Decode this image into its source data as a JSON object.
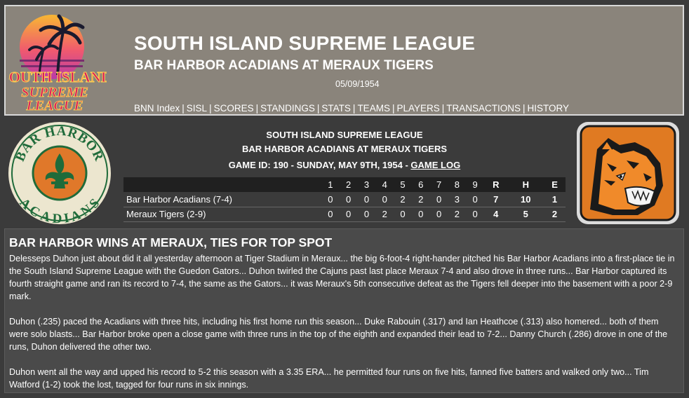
{
  "header": {
    "logo_text": [
      "SOUTH ISLAND",
      "SUPREME",
      "LEAGUE"
    ],
    "title": "SOUTH ISLAND SUPREME LEAGUE",
    "subtitle": "BAR HARBOR ACADIANS AT MERAUX TIGERS",
    "date": "05/09/1954",
    "nav": [
      "BNN Index",
      "SISL",
      "SCORES",
      "STANDINGS",
      "STATS",
      "TEAMS",
      "PLAYERS",
      "TRANSACTIONS",
      "HISTORY"
    ]
  },
  "game": {
    "league": "SOUTH ISLAND SUPREME LEAGUE",
    "matchup": "BAR HARBOR ACADIANS AT MERAUX TIGERS",
    "game_id_text": "GAME ID: 190 - SUNDAY, MAY 9TH, 1954 - ",
    "game_log_label": "GAME LOG",
    "away_logo_text": [
      "BAR HARBOR",
      "ACADIANS"
    ]
  },
  "boxscore": {
    "columns": [
      "1",
      "2",
      "3",
      "4",
      "5",
      "6",
      "7",
      "8",
      "9",
      "R",
      "H",
      "E"
    ],
    "rows": [
      {
        "team": "Bar Harbor Acadians (7-4)",
        "innings": [
          "0",
          "0",
          "0",
          "0",
          "2",
          "2",
          "0",
          "3",
          "0"
        ],
        "r": "7",
        "h": "10",
        "e": "1"
      },
      {
        "team": "Meraux Tigers (2-9)",
        "innings": [
          "0",
          "0",
          "0",
          "2",
          "0",
          "0",
          "0",
          "2",
          "0"
        ],
        "r": "4",
        "h": "5",
        "e": "2"
      }
    ]
  },
  "article": {
    "headline": "BAR HARBOR WINS AT MERAUX, TIES FOR TOP SPOT",
    "paragraphs": [
      "Delesseps Duhon just about did it all yesterday afternoon at Tiger Stadium in Meraux... the big 6-foot-4 right-hander pitched his Bar Harbor Acadians into a first-place tie in the South Island Supreme League with the Guedon Gators... Duhon twirled the Cajuns past last place Meraux 7-4 and also drove in three runs... Bar Harbor captured its fourth straight game and ran its record to 7-4, the same as the Gators... it was Meraux's 5th consecutive defeat as the Tigers fell deeper into the basement with a poor 2-9 mark.",
      "Duhon (.235) paced the Acadians with three hits, including his first home run this season... Duke Rabouin (.317) and Ian Heathcoe (.313) also homered... both of them were solo blasts... Bar Harbor broke open a close game with three runs in the top of the eighth and expanded their lead to 7-2... Danny Church (.286) drove in one of the runs, Duhon delivered the other two.",
      "Duhon went all the way and upped his record to 5-2 this season with a 3.35 ERA... he permitted four runs on five hits, fanned five batters and walked only two... Tim Watford (1-2) took the lost, tagged for four runs in six innings."
    ]
  },
  "colors": {
    "header_bg": "#8a847b",
    "page_bg": "#3b3b3b",
    "article_bg": "#4a4a4a",
    "acadians_green": "#1f6b3a",
    "acadians_orange": "#e0782a",
    "tigers_orange": "#e07a22"
  }
}
